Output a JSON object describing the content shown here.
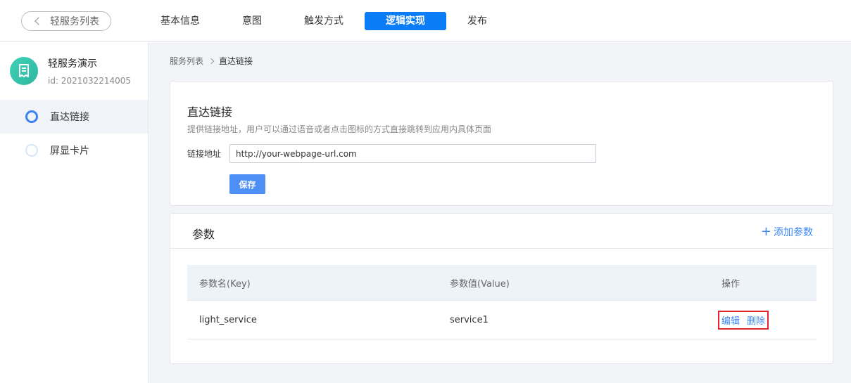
{
  "header": {
    "back_label": "轻服务列表",
    "tabs": [
      {
        "label": "基本信息",
        "active": false
      },
      {
        "label": "意图",
        "active": false
      },
      {
        "label": "触发方式",
        "active": false
      },
      {
        "label": "逻辑实现",
        "active": true
      },
      {
        "label": "发布",
        "active": false
      }
    ]
  },
  "sidebar": {
    "app_name": "轻服务演示",
    "app_id": "id: 2021032214005",
    "items": [
      {
        "label": "直达链接",
        "active": true
      },
      {
        "label": "屏显卡片",
        "active": false
      }
    ]
  },
  "breadcrumb": {
    "root": "服务列表",
    "current": "直达链接"
  },
  "direct_link": {
    "title": "直达链接",
    "description": "提供链接地址，用户可以通过语音或者点击图标的方式直接跳转到应用内具体页面",
    "field_label": "链接地址",
    "url_value": "http://your-webpage-url.com",
    "save_label": "保存"
  },
  "params": {
    "title": "参数",
    "add_label": "添加参数",
    "columns": [
      "参数名(Key)",
      "参数值(Value)",
      "操作"
    ],
    "rows": [
      {
        "key": "light_service",
        "value": "service1",
        "edit": "编辑",
        "delete": "删除"
      }
    ]
  },
  "colors": {
    "accent": "#0a7cf5",
    "link": "#3b86f5",
    "highlight_border": "#e3262d"
  }
}
